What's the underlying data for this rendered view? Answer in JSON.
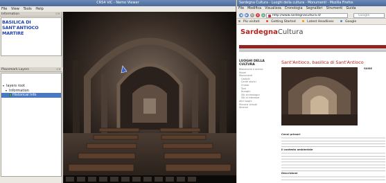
{
  "viewer": {
    "title": "CRS4 ViC - Nemo Viewer",
    "menu": [
      "File",
      "View",
      "Tools",
      "Help"
    ],
    "info_panel": {
      "header": "Information",
      "title_lines": [
        "BASILICA DI",
        "SANT'ANTIOCO",
        "MARTIRE"
      ]
    },
    "layers_panel": {
      "header": "Placemark Layers",
      "tree": [
        {
          "label": "layers root",
          "level": 0,
          "expanded": true
        },
        {
          "label": "Information",
          "level": 1,
          "expanded": true
        },
        {
          "label": "Historical Info",
          "level": 2,
          "selected": true
        }
      ]
    }
  },
  "browser": {
    "title": "Sardegna Cultura - Luoghi della cultura - Monumenti - Mozilla Firefox",
    "menu": [
      "File",
      "Modifica",
      "Visualizza",
      "Cronologia",
      "Segnalibri",
      "Strumenti",
      "Guida"
    ],
    "url": "http://www.sardegnacultura.it/",
    "search_placeholder": "Google",
    "bookmarks": [
      "Più visitati",
      "Getting Started",
      "Latest Headlines",
      "Google"
    ],
    "page": {
      "logo_part1": "Sardegna",
      "logo_part2": "Cultura",
      "heading": "Sant'Antioco, basilica di Sant'Antioco",
      "sidebar_title": "LUOGHI DELLA CULTURA",
      "sidebar_items": [
        "Biblioteche e archivi",
        "Musei",
        "Monumenti",
        "Castelli",
        "Centri storici",
        "Chiese",
        "Torri",
        "Nuraghi",
        "Siti archeologici",
        "Siti di interesse",
        "Altri luoghi",
        "Percorsi virtuali",
        "Itinerari"
      ],
      "section_1": "Cenni primari",
      "section_2": "Il contesto ambientale",
      "section_3": "Descrizione",
      "guide_title": "GUIDE"
    },
    "accent_color": "#b2231d"
  }
}
